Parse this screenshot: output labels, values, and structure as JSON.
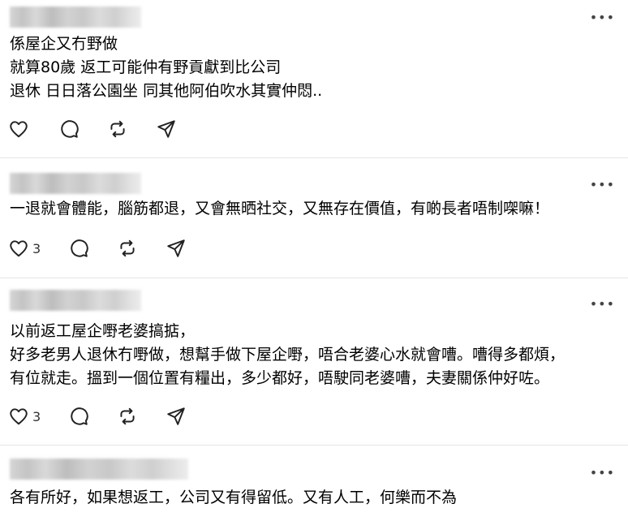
{
  "posts": [
    {
      "lines": [
        "係屋企又冇野做",
        "就算80歲 返工可能仲有野貢獻到比公司",
        "退休 日日落公園坐 同其他阿伯吹水其實仲悶.."
      ],
      "likes": ""
    },
    {
      "lines": [
        "一退就會體能，腦筋都退，又會無晒社交，又無存在價值，有啲長者唔制㗎嘛！"
      ],
      "likes": "3"
    },
    {
      "lines": [
        "以前返工屋企嘢老婆搞掂，",
        "好多老男人退休冇嘢做，想幫手做下屋企嘢，唔合老婆心水就會嘈。嘈得多都煩，",
        "有位就走。搵到一個位置有糧出，多少都好，唔駛同老婆嘈，夫妻關係仲好咗。"
      ],
      "likes": "3"
    },
    {
      "lines": [
        "各有所好，如果想返工，公司又有得留低。又有人工，何樂而不為"
      ],
      "likes": ""
    }
  ],
  "more_label": "•••",
  "icons": [
    "heart-icon",
    "comment-icon",
    "repost-icon",
    "share-icon",
    "more-icon"
  ]
}
